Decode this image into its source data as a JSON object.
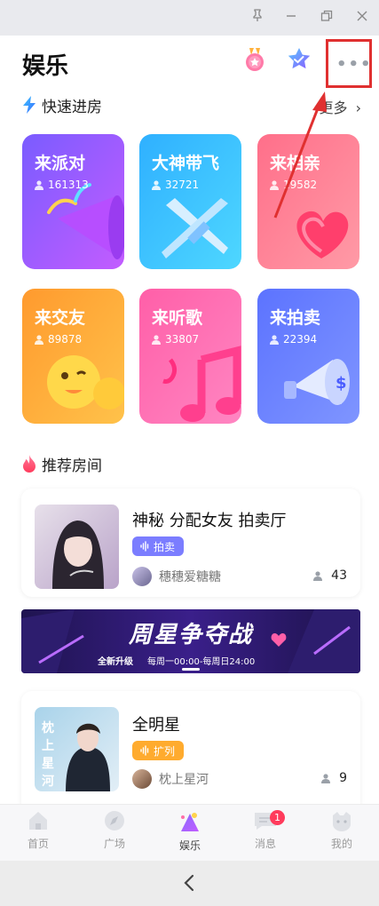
{
  "window": {
    "pin_icon": "pin-icon",
    "minimize_icon": "minimize-icon",
    "restore_icon": "restore-icon",
    "close_icon": "close-icon"
  },
  "header": {
    "title": "娱乐",
    "icons": [
      "medal-icon",
      "star-badge-icon",
      "more-icon"
    ]
  },
  "quick_rooms": {
    "title": "快速进房",
    "more": "更多",
    "cards": [
      {
        "title": "来派对",
        "count": "161313",
        "icon": "party-popper-icon",
        "colors": [
          "#7a5cff",
          "#c35cff"
        ]
      },
      {
        "title": "大神带飞",
        "count": "32721",
        "icon": "crossed-swords-icon",
        "colors": [
          "#2fb0ff",
          "#4ed7ff"
        ]
      },
      {
        "title": "来相亲",
        "count": "19582",
        "icon": "heart-icon",
        "colors": [
          "#ff6f8a",
          "#ff9aa6"
        ]
      },
      {
        "title": "来交友",
        "count": "89878",
        "icon": "emoji-chat-icon",
        "colors": [
          "#ff9a2e",
          "#ffc24a"
        ]
      },
      {
        "title": "来听歌",
        "count": "33807",
        "icon": "music-note-icon",
        "colors": [
          "#ff5fa8",
          "#ff86c2"
        ]
      },
      {
        "title": "来拍卖",
        "count": "22394",
        "icon": "megaphone-icon",
        "colors": [
          "#5c73ff",
          "#7f95ff"
        ]
      }
    ]
  },
  "recommended": {
    "title": "推荐房间",
    "rooms": [
      {
        "title": "神秘  分配女友  拍卖厅",
        "tag": "拍卖",
        "tag_color": "#7b7dff",
        "host": "穗穗爱糖糖",
        "users": "43"
      },
      {
        "title": "全明星",
        "tag": "扩列",
        "tag_color": "#ffab2e",
        "host": "枕上星河",
        "users": "9"
      }
    ],
    "banner": {
      "title": "周星争夺战",
      "subtitle": "全新升级",
      "schedule": "每周一00:00-每周日24:00"
    }
  },
  "tabs": [
    {
      "label": "首页",
      "icon": "home-icon"
    },
    {
      "label": "广场",
      "icon": "compass-icon"
    },
    {
      "label": "娱乐",
      "icon": "party-hat-icon",
      "active": true
    },
    {
      "label": "消息",
      "icon": "chat-icon",
      "badge": "1"
    },
    {
      "label": "我的",
      "icon": "profile-icon"
    }
  ],
  "annotation_color": "#e03030"
}
